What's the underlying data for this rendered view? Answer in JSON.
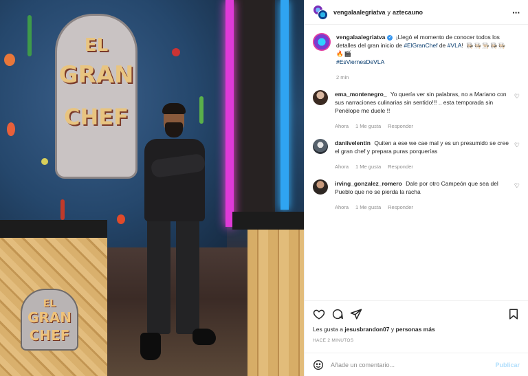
{
  "header": {
    "username": "vengalaalegriatva",
    "connector": "y",
    "coauthor": "aztecauno"
  },
  "media": {
    "set_logo": {
      "line1": "EL",
      "line2": "GRAN",
      "line3": "CHEF"
    },
    "corner_logo": {
      "line1": "EL",
      "line2": "GRAN",
      "line3": "CHEF"
    }
  },
  "caption": {
    "username": "vengalaalegriatva",
    "text": "¡Llegó el momento de conocer todos los detalles del gran inicio de",
    "hashtag1": "#ElGranChef",
    "connector": "de",
    "hashtag2": "#VLA",
    "emojis": "! 👩🏻‍🍳🧑🏻‍🍳👨🏻‍🍳👩🏻‍🍳🧑🏻‍🍳🔥🎬",
    "hashtag3": "#EsViernesDeVLA",
    "time": "2 min"
  },
  "comments": [
    {
      "username": "ema_montenegro_",
      "text": "Yo quería ver sin palabras, no a Mariano con sus narraciones culinarias sin sentido!!! .. esta temporada sin Penélope me duele !!",
      "time": "Ahora",
      "likes": "1 Me gusta",
      "reply": "Responder"
    },
    {
      "username": "daniivelentin",
      "text": "Quiten a ese we cae mal y es un presumido se cree el gran chef y prepara puras porquerías",
      "time": "Ahora",
      "likes": "1 Me gusta",
      "reply": "Responder"
    },
    {
      "username": "irving_gonzalez_romero",
      "text": "Dale por otro Campeón que sea del Pueblo que no se pierda la racha",
      "time": "Ahora",
      "likes": "1 Me gusta",
      "reply": "Responder"
    }
  ],
  "likes": {
    "prefix": "Les gusta a",
    "user": "jesusbrandon07",
    "connector": "y",
    "others": "personas más"
  },
  "posted": "HACE 2 MINUTOS",
  "comment_box": {
    "placeholder": "Añade un comentario...",
    "publish": "Publicar"
  },
  "icons": {
    "more": "more-options-icon",
    "like": "heart-icon",
    "comment": "comment-bubble-icon",
    "share": "send-icon",
    "save": "bookmark-icon",
    "emoji": "emoji-icon",
    "comment_like": "heart-icon"
  },
  "colors": {
    "link": "#00376b",
    "muted": "#8e8e8e",
    "publish": "#b2dffc",
    "verified": "#3897f0",
    "neon_pink": "#e03ad8",
    "neon_blue": "#2fa4f2"
  }
}
